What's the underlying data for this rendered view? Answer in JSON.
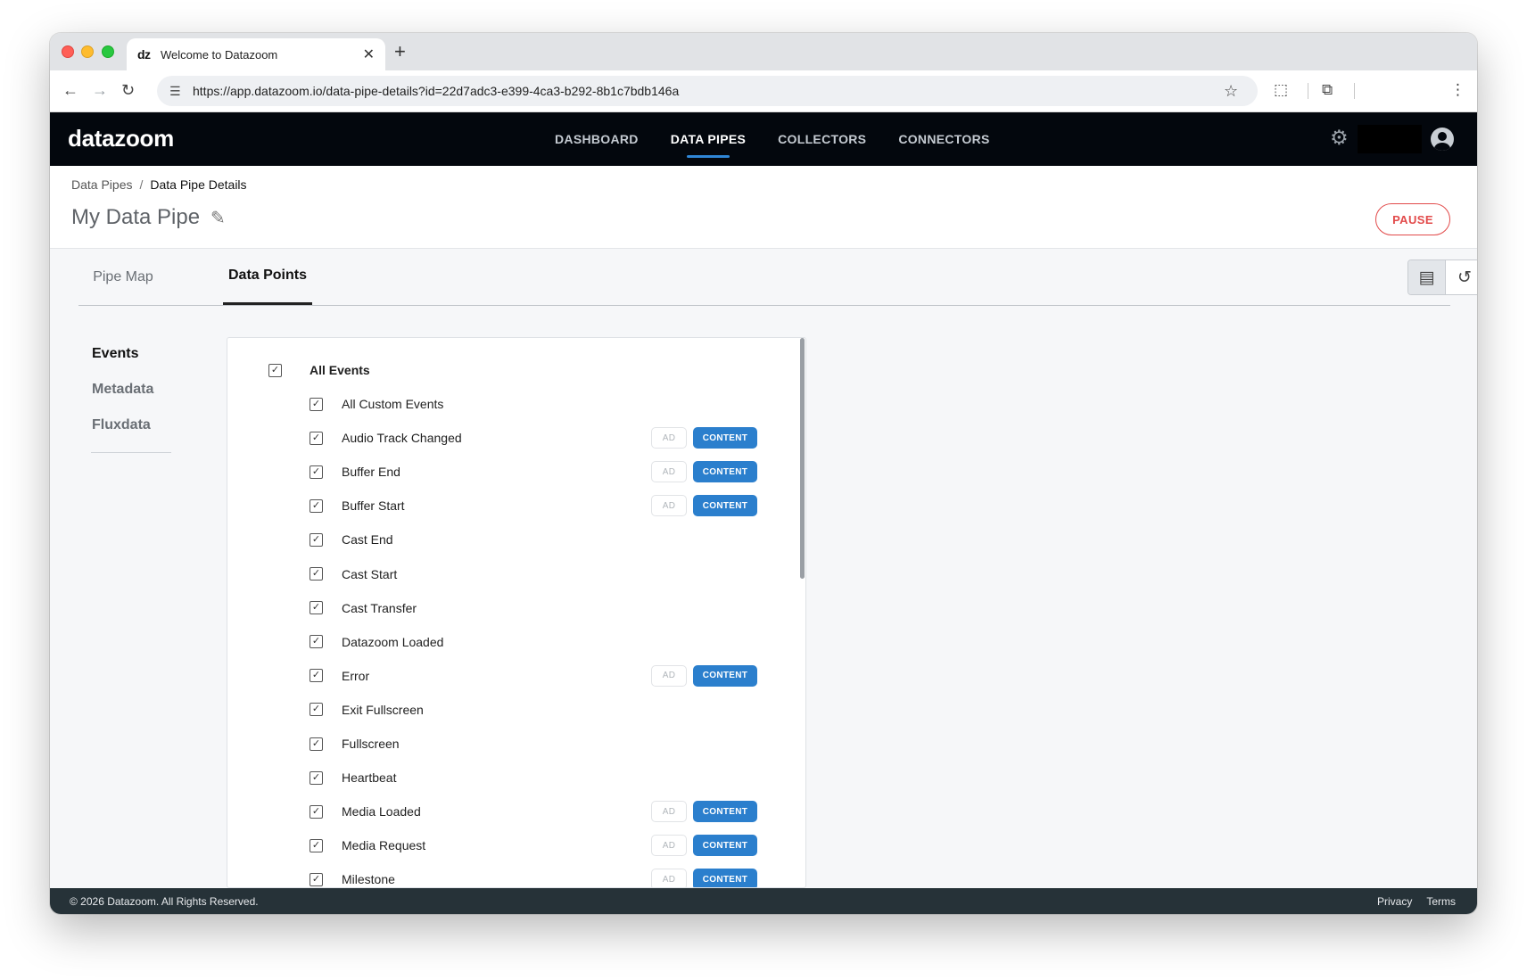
{
  "browser": {
    "tab_title": "Welcome to Datazoom",
    "favicon_text": "dz",
    "url": "https://app.datazoom.io/data-pipe-details?id=22d7adc3-e399-4ca3-b292-8b1c7bdb146a"
  },
  "app": {
    "logo": "datazoom",
    "nav": [
      "DASHBOARD",
      "DATA PIPES",
      "COLLECTORS",
      "CONNECTORS"
    ],
    "active_nav": "DATA PIPES"
  },
  "page": {
    "breadcrumb": [
      "Data Pipes",
      "Data Pipe Details"
    ],
    "title": "My Data Pipe",
    "pause_label": "PAUSE"
  },
  "tabs": {
    "items": [
      "Pipe Map",
      "Data Points"
    ],
    "active": "Data Points"
  },
  "sidebar": {
    "items": [
      "Events",
      "Metadata",
      "Fluxdata"
    ],
    "active": "Events"
  },
  "events": {
    "all_label": "All Events",
    "ad_label": "AD",
    "content_label": "CONTENT",
    "items": [
      {
        "label": "All Custom Events",
        "badges": false
      },
      {
        "label": "Audio Track Changed",
        "badges": true
      },
      {
        "label": "Buffer End",
        "badges": true
      },
      {
        "label": "Buffer Start",
        "badges": true
      },
      {
        "label": "Cast End",
        "badges": false
      },
      {
        "label": "Cast Start",
        "badges": false
      },
      {
        "label": "Cast Transfer",
        "badges": false
      },
      {
        "label": "Datazoom Loaded",
        "badges": false
      },
      {
        "label": "Error",
        "badges": true
      },
      {
        "label": "Exit Fullscreen",
        "badges": false
      },
      {
        "label": "Fullscreen",
        "badges": false
      },
      {
        "label": "Heartbeat",
        "badges": false
      },
      {
        "label": "Media Loaded",
        "badges": true
      },
      {
        "label": "Media Request",
        "badges": true
      },
      {
        "label": "Milestone",
        "badges": true
      }
    ]
  },
  "footer": {
    "copyright": "© 2026 Datazoom. All Rights Reserved.",
    "links": [
      "Privacy",
      "Terms"
    ]
  },
  "icons": {
    "checkbox_checked": "✓",
    "edit": "✎",
    "gear": "⚙"
  }
}
